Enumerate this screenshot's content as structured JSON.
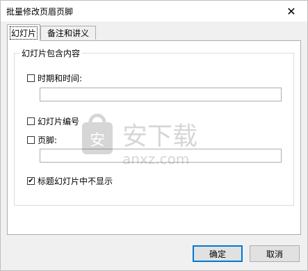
{
  "window": {
    "title": "批量修改页眉页脚"
  },
  "tabs": [
    {
      "label": "幻灯片",
      "active": true
    },
    {
      "label": "备注和讲义",
      "active": false
    }
  ],
  "group": {
    "label": "幻灯片包含内容",
    "datetime": {
      "label": "时期和时间:",
      "checked": false,
      "value": ""
    },
    "slide_number": {
      "label": "幻灯片编号",
      "checked": false
    },
    "footer": {
      "label": "页脚:",
      "checked": false,
      "value": ""
    },
    "hide_on_title": {
      "label": "标题幻灯片中不显示",
      "checked": true
    }
  },
  "buttons": {
    "ok": "确定",
    "cancel": "取消"
  },
  "watermark": {
    "text": "安下载",
    "sub": "anxz.com"
  }
}
